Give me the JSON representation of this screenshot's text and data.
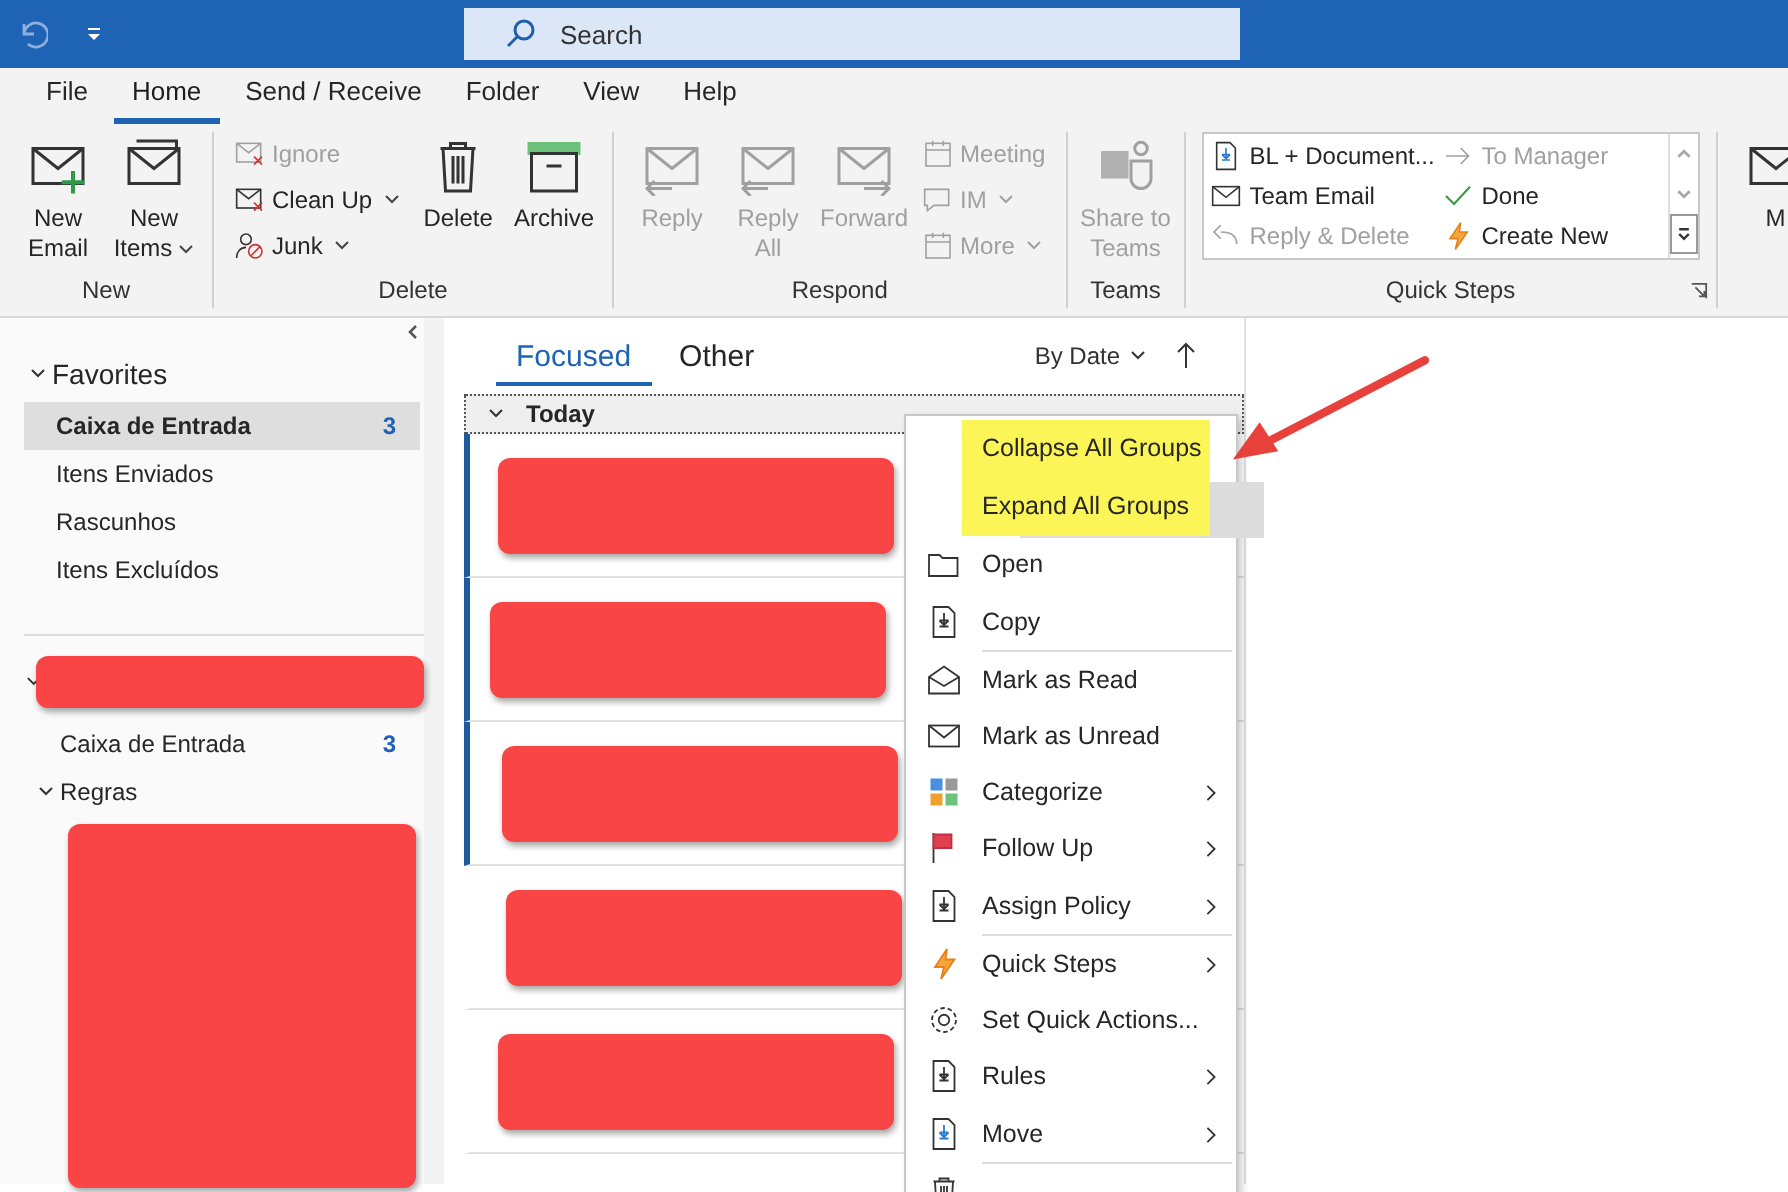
{
  "search": {
    "placeholder": "Search"
  },
  "ribbon_tabs": [
    {
      "label": "File",
      "selected": false
    },
    {
      "label": "Home",
      "selected": true
    },
    {
      "label": "Send / Receive",
      "selected": false
    },
    {
      "label": "Folder",
      "selected": false
    },
    {
      "label": "View",
      "selected": false
    },
    {
      "label": "Help",
      "selected": false
    }
  ],
  "ribbon_groups": [
    {
      "label": "New",
      "large": [
        {
          "label": "New Email",
          "dropdown": false,
          "disabled": false
        },
        {
          "label": "New Items",
          "dropdown": true,
          "disabled": false
        }
      ]
    },
    {
      "label": "Delete",
      "small": [
        {
          "label": "Ignore",
          "dropdown": false,
          "disabled": true
        },
        {
          "label": "Clean Up",
          "dropdown": true,
          "disabled": false
        },
        {
          "label": "Junk",
          "dropdown": true,
          "disabled": false
        }
      ],
      "after": [
        {
          "label": "Delete",
          "disabled": false
        },
        {
          "label": "Archive",
          "disabled": false
        }
      ]
    },
    {
      "label": "Respond",
      "large": [
        {
          "label": "Reply",
          "dropdown": false,
          "disabled": true
        },
        {
          "label": "Reply All",
          "dropdown": false,
          "disabled": true
        },
        {
          "label": "Forward",
          "dropdown": false,
          "disabled": true
        }
      ],
      "small": [
        {
          "label": "Meeting",
          "dropdown": false,
          "disabled": true
        },
        {
          "label": "IM",
          "dropdown": true,
          "disabled": true
        },
        {
          "label": "More",
          "dropdown": true,
          "disabled": true
        }
      ]
    },
    {
      "label": "Teams",
      "large": [
        {
          "label": "Share to Teams",
          "dropdown": false,
          "disabled": true
        }
      ]
    }
  ],
  "quick_steps": {
    "label": "Quick Steps",
    "items": [
      {
        "label": "BL + Document...",
        "disabled": false
      },
      {
        "label": "To Manager",
        "disabled": true
      },
      {
        "label": "Team Email",
        "disabled": false
      },
      {
        "label": "Done",
        "disabled": false
      },
      {
        "label": "Reply & Delete",
        "disabled": true
      },
      {
        "label": "Create New",
        "disabled": false
      }
    ]
  },
  "ribbon_cut_label": "M",
  "favorites": {
    "label": "Favorites",
    "expanded": true,
    "items": [
      {
        "label": "Caixa de Entrada",
        "count": "3",
        "selected": true
      },
      {
        "label": "Itens Enviados",
        "selected": false
      },
      {
        "label": "Rascunhos",
        "selected": false
      },
      {
        "label": "Itens Excluídos",
        "selected": false
      }
    ]
  },
  "mailbox": {
    "expanded": true,
    "folders": [
      {
        "label": "Caixa de Entrada",
        "count": "3",
        "expanded": false
      },
      {
        "label": "Regras",
        "expanded": true
      }
    ]
  },
  "message_tabs": [
    {
      "label": "Focused",
      "selected": true
    },
    {
      "label": "Other",
      "selected": false
    }
  ],
  "sort": {
    "label": "By Date"
  },
  "group": {
    "label": "Today",
    "expanded": true
  },
  "messages": [
    {
      "unread": true
    },
    {
      "unread": true
    },
    {
      "unread": true
    },
    {
      "unread": false
    },
    {
      "unread": false
    }
  ],
  "context_menu": [
    {
      "label": "Collapse All Groups",
      "highlighted": true,
      "submenu": false,
      "separator_after": false
    },
    {
      "label": "Expand All Groups",
      "highlighted": true,
      "submenu": false,
      "separator_after": true
    },
    {
      "label": "Open",
      "highlighted": false,
      "submenu": false,
      "separator_after": false
    },
    {
      "label": "Copy",
      "highlighted": false,
      "submenu": false,
      "separator_after": true
    },
    {
      "label": "Mark as Read",
      "highlighted": false,
      "submenu": false,
      "separator_after": false
    },
    {
      "label": "Mark as Unread",
      "highlighted": false,
      "submenu": false,
      "separator_after": false
    },
    {
      "label": "Categorize",
      "highlighted": false,
      "submenu": true,
      "separator_after": false
    },
    {
      "label": "Follow Up",
      "highlighted": false,
      "submenu": true,
      "separator_after": false
    },
    {
      "label": "Assign Policy",
      "highlighted": false,
      "submenu": true,
      "separator_after": true
    },
    {
      "label": "Quick Steps",
      "highlighted": false,
      "submenu": true,
      "separator_after": false
    },
    {
      "label": "Set Quick Actions...",
      "highlighted": false,
      "submenu": false,
      "separator_after": false
    },
    {
      "label": "Rules",
      "highlighted": false,
      "submenu": true,
      "separator_after": false
    },
    {
      "label": "Move",
      "highlighted": false,
      "submenu": true,
      "separator_after": true
    }
  ]
}
